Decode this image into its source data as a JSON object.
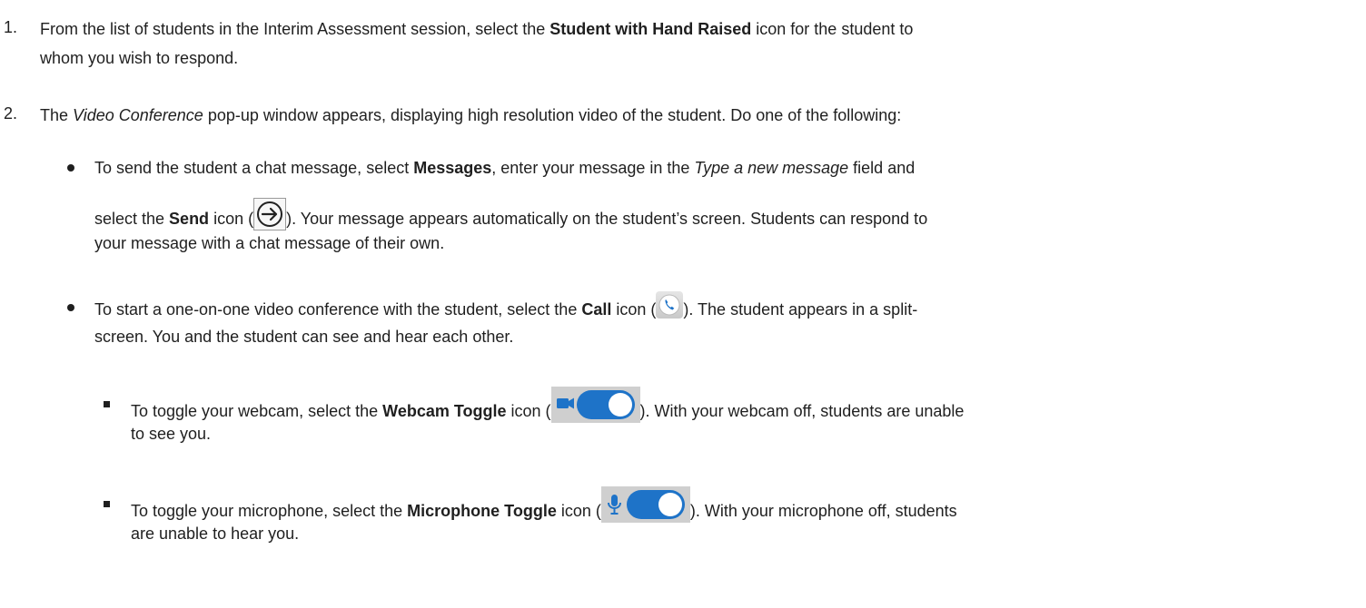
{
  "step1": {
    "number": "1.",
    "line1_pre": "From the list of students in the Interim Assessment session, select the ",
    "line1_bold": "Student with Hand Raised",
    "line1_post": " icon for the student to",
    "line2": "whom you wish to respond."
  },
  "step2": {
    "number": "2.",
    "pre": "The ",
    "italic": "Video Conference",
    "post": " pop-up window appears, displaying high resolution video of the student. Do one of the following:"
  },
  "bullet_messages": {
    "l1_a": "To send the student a chat message, select ",
    "l1_bold": "Messages",
    "l1_b": ", enter your message in the ",
    "l1_italic": "Type a new message",
    "l1_c": " field and",
    "l2_a": "select the ",
    "l2_bold": "Send",
    "l2_b": " icon (",
    "l2_c": "). Your message appears automatically on the student’s screen. Students can respond to",
    "l3": "your message with a chat message of their own.",
    "send_icon": "send-arrow-icon"
  },
  "bullet_call": {
    "l1_a": "To start a one-on-one video conference with the student, select the ",
    "l1_bold": "Call",
    "l1_b": " icon (",
    "l1_c": "). The student appears in a split-",
    "l2": "screen. You and the student can see and hear each other.",
    "call_icon": "phone-icon",
    "icon_color": "#1e73c8"
  },
  "sub_webcam": {
    "l1_a": "To toggle your webcam, select the ",
    "l1_bold": "Webcam Toggle",
    "l1_b": " icon (",
    "l1_c": "). With your webcam off, students are unable",
    "l2": "to see you.",
    "toggle_icon": "webcam-toggle-icon",
    "on_color": "#1e73c8"
  },
  "sub_mic": {
    "l1_a": "To toggle your microphone, select the ",
    "l1_bold": "Microphone Toggle",
    "l1_b": " icon (",
    "l1_c": "). With your microphone off, students",
    "l2": "are unable to hear you.",
    "toggle_icon": "microphone-toggle-icon",
    "on_color": "#1e73c8"
  }
}
